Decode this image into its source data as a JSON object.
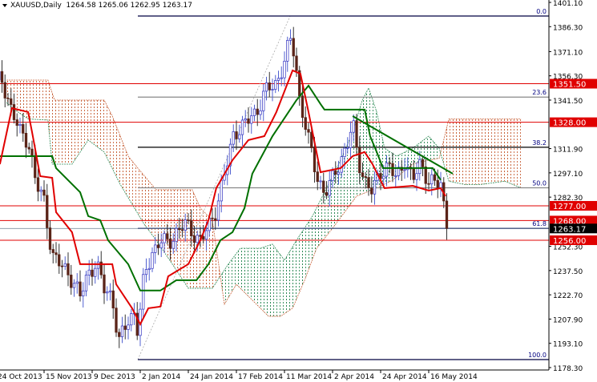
{
  "header": {
    "symbol_timeframe": "XAUUSD,Daily",
    "ohlc": "1264.58 1265.06 1262.95 1263.17"
  },
  "chart_data": {
    "type": "candlestick",
    "title": "XAUUSD,Daily",
    "ylim": [
      1178.3,
      1401.1
    ],
    "y_ticks": [
      "1401.10",
      "1386.30",
      "1371.10",
      "1356.30",
      "1341.50",
      "1311.90",
      "1297.10",
      "1282.30",
      "1252.30",
      "1237.50",
      "1222.70",
      "1207.90",
      "1193.10",
      "1178.30"
    ],
    "x_ticks": [
      {
        "bar": 0,
        "label": "24 Oct 2013"
      },
      {
        "bar": 16,
        "label": "15 Nov 2013"
      },
      {
        "bar": 32,
        "label": "9 Dec 2013"
      },
      {
        "bar": 48,
        "label": "2 Jan 2014"
      },
      {
        "bar": 64,
        "label": "24 Jan 2014"
      },
      {
        "bar": 80,
        "label": "17 Feb 2014"
      },
      {
        "bar": 96,
        "label": "11 Mar 2014"
      },
      {
        "bar": 112,
        "label": "2 Apr 2014"
      },
      {
        "bar": 128,
        "label": "24 Apr 2014"
      },
      {
        "bar": 144,
        "label": "16 May 2014"
      }
    ],
    "last_bar": 150,
    "price_path": [
      [
        2.1,
        1353.7
      ],
      [
        5.3,
        1334.2
      ],
      [
        8,
        1322
      ],
      [
        10.7,
        1317.1
      ],
      [
        13.3,
        1290.2
      ],
      [
        16,
        1280.4
      ],
      [
        18.7,
        1246.2
      ],
      [
        21.3,
        1241.4
      ],
      [
        24,
        1236.5
      ],
      [
        28,
        1221.8
      ],
      [
        30.7,
        1236.5
      ],
      [
        33.3,
        1241.4
      ],
      [
        36,
        1226.7
      ],
      [
        38.7,
        1221.8
      ],
      [
        40.8,
        1192.5
      ],
      [
        42.7,
        1202.3
      ],
      [
        44,
        1207.2
      ],
      [
        46.1,
        1212.1
      ],
      [
        47.2,
        1199.8
      ],
      [
        49.3,
        1234
      ],
      [
        52,
        1248.7
      ],
      [
        54.7,
        1256
      ],
      [
        57.3,
        1253.6
      ],
      [
        60,
        1260.9
      ],
      [
        62.7,
        1265.8
      ],
      [
        65.3,
        1260.9
      ],
      [
        68,
        1256
      ],
      [
        70.7,
        1263.3
      ],
      [
        73.3,
        1275.6
      ],
      [
        75.5,
        1292.7
      ],
      [
        77.3,
        1304.9
      ],
      [
        79.2,
        1322
      ],
      [
        81.3,
        1324.4
      ],
      [
        84,
        1329.3
      ],
      [
        86.7,
        1334.2
      ],
      [
        89.3,
        1346.4
      ],
      [
        93.3,
        1351.3
      ],
      [
        96,
        1365.9
      ],
      [
        97.9,
        1378.2
      ],
      [
        99.5,
        1368.4
      ],
      [
        100.8,
        1344
      ],
      [
        102.7,
        1329.3
      ],
      [
        104.8,
        1309.8
      ],
      [
        106.7,
        1295.1
      ],
      [
        109.3,
        1285.3
      ],
      [
        112,
        1292.7
      ],
      [
        114.7,
        1304.9
      ],
      [
        117.3,
        1317.1
      ],
      [
        118.7,
        1326.9
      ],
      [
        120.5,
        1304.9
      ],
      [
        122.7,
        1292.7
      ],
      [
        125.3,
        1285.3
      ],
      [
        128,
        1297.5
      ],
      [
        130.7,
        1302.4
      ],
      [
        133.3,
        1292.7
      ],
      [
        136,
        1304.9
      ],
      [
        138.7,
        1292.7
      ],
      [
        141.3,
        1302.4
      ],
      [
        144,
        1292.7
      ],
      [
        146.7,
        1290.2
      ],
      [
        148.5,
        1289.2
      ],
      [
        149.6,
        1263.17
      ]
    ],
    "tenkan_sen": {
      "color": "#e00000",
      "points": [
        [
          1.3,
          1302.4
        ],
        [
          5.3,
          1336.6
        ],
        [
          10.7,
          1334.2
        ],
        [
          12,
          1322
        ],
        [
          14.7,
          1295.1
        ],
        [
          18.7,
          1294.1
        ],
        [
          20,
          1273.1
        ],
        [
          25.3,
          1260.9
        ],
        [
          28,
          1241.4
        ],
        [
          38.7,
          1241.4
        ],
        [
          40,
          1229.1
        ],
        [
          45.3,
          1214.5
        ],
        [
          48,
          1204.7
        ],
        [
          50.7,
          1214.5
        ],
        [
          54.7,
          1215.5
        ],
        [
          57.3,
          1234
        ],
        [
          64,
          1241.4
        ],
        [
          68,
          1256
        ],
        [
          70.7,
          1268.2
        ],
        [
          73.3,
          1287.8
        ],
        [
          78.7,
          1304.9
        ],
        [
          84,
          1317.1
        ],
        [
          89.3,
          1319.5
        ],
        [
          93.3,
          1334.2
        ],
        [
          98.7,
          1359.6
        ],
        [
          101.3,
          1357.6
        ],
        [
          104,
          1334.2
        ],
        [
          108,
          1297.5
        ],
        [
          114.7,
          1300
        ],
        [
          118.7,
          1307.3
        ],
        [
          122.7,
          1309.8
        ],
        [
          125.3,
          1302.4
        ],
        [
          129.3,
          1287.8
        ],
        [
          138.7,
          1289.2
        ],
        [
          144,
          1286.3
        ],
        [
          148,
          1287.8
        ],
        [
          149.6,
          1282.9
        ]
      ]
    },
    "kijun_sen": {
      "color": "#007000",
      "points": [
        [
          1.3,
          1307.3
        ],
        [
          18.7,
          1307.3
        ],
        [
          20,
          1300
        ],
        [
          28,
          1285.3
        ],
        [
          30.7,
          1270.7
        ],
        [
          34.7,
          1268.2
        ],
        [
          37.3,
          1256
        ],
        [
          44,
          1241.4
        ],
        [
          48,
          1225.3
        ],
        [
          54.7,
          1225.3
        ],
        [
          60,
          1231.6
        ],
        [
          66.7,
          1231.6
        ],
        [
          70.7,
          1241.4
        ],
        [
          74.7,
          1256
        ],
        [
          78.7,
          1260.9
        ],
        [
          82.7,
          1275.6
        ],
        [
          85.3,
          1296.6
        ],
        [
          92,
          1319.5
        ],
        [
          100,
          1341.5
        ],
        [
          104,
          1350.3
        ],
        [
          108,
          1339.1
        ],
        [
          109.3,
          1335.7
        ],
        [
          122.7,
          1335.7
        ],
        [
          124.5,
          1319.5
        ],
        [
          126.7,
          1309.8
        ],
        [
          128.8,
          1300
        ],
        [
          145.3,
          1300
        ],
        [
          148,
          1292.7
        ]
      ]
    },
    "senkou_span_a": [
      [
        3.5,
        1340
      ],
      [
        6.7,
        1335
      ],
      [
        10.7,
        1330
      ],
      [
        17.3,
        1329.3
      ],
      [
        18.7,
        1302.4
      ],
      [
        25.3,
        1302.4
      ],
      [
        30.7,
        1317.1
      ],
      [
        36,
        1309.8
      ],
      [
        41.3,
        1290.2
      ],
      [
        45.3,
        1278
      ],
      [
        49.3,
        1265.8
      ],
      [
        53.3,
        1256
      ],
      [
        58.7,
        1241.4
      ],
      [
        64,
        1226.7
      ],
      [
        72,
        1226.7
      ],
      [
        77.3,
        1241.4
      ],
      [
        81.3,
        1251.1
      ],
      [
        88,
        1251.1
      ],
      [
        92,
        1253.6
      ],
      [
        96,
        1243.8
      ],
      [
        100,
        1256
      ],
      [
        105.3,
        1270.7
      ],
      [
        109.3,
        1285.3
      ],
      [
        114.7,
        1304.9
      ],
      [
        118.7,
        1322
      ],
      [
        121.9,
        1341.5
      ],
      [
        124,
        1348.9
      ],
      [
        126.7,
        1334.2
      ],
      [
        129.3,
        1312.2
      ],
      [
        133.3,
        1307.3
      ],
      [
        138.7,
        1312.2
      ],
      [
        144,
        1319.5
      ],
      [
        147.5,
        1312
      ],
      [
        150.7,
        1292
      ],
      [
        156,
        1290
      ],
      [
        161.3,
        1290
      ],
      [
        169.3,
        1292
      ],
      [
        174.7,
        1288
      ]
    ],
    "senkou_span_b": [
      [
        3.5,
        1353.7
      ],
      [
        17.3,
        1353.7
      ],
      [
        19.5,
        1341.5
      ],
      [
        36,
        1341.5
      ],
      [
        38.7,
        1331.8
      ],
      [
        44,
        1307.3
      ],
      [
        47.2,
        1300
      ],
      [
        53.3,
        1286.8
      ],
      [
        65.3,
        1286.8
      ],
      [
        68,
        1275.6
      ],
      [
        72,
        1268.2
      ],
      [
        76,
        1216.9
      ],
      [
        80,
        1229.1
      ],
      [
        84,
        1221.8
      ],
      [
        90.7,
        1209.6
      ],
      [
        94.7,
        1209.6
      ],
      [
        98.7,
        1214.5
      ],
      [
        102.7,
        1231.6
      ],
      [
        106.7,
        1251.1
      ],
      [
        112,
        1263.3
      ],
      [
        116,
        1273.1
      ],
      [
        120,
        1282.9
      ],
      [
        126.7,
        1287.8
      ],
      [
        132,
        1292.7
      ],
      [
        138.7,
        1302.4
      ],
      [
        144,
        1304.9
      ],
      [
        147.5,
        1306
      ],
      [
        150.7,
        1330
      ],
      [
        156,
        1330
      ],
      [
        161.3,
        1330
      ],
      [
        169.3,
        1330
      ],
      [
        174.7,
        1330
      ]
    ],
    "cloud_colors": {
      "bullish": "#2e8b57",
      "bearish": "#c8643c"
    },
    "horizontal_levels": [
      {
        "price": 1351.5,
        "label": "1351.50"
      },
      {
        "price": 1328.0,
        "label": "1328.00"
      },
      {
        "price": 1277.0,
        "label": "1277.00"
      },
      {
        "price": 1268.0,
        "label": "1268.00"
      },
      {
        "price": 1256.0,
        "label": "1256.00"
      }
    ],
    "level_color": "#e00000",
    "current_price": {
      "price": 1263.17,
      "label": "1263.17"
    },
    "fibonacci": {
      "start_bar": 47.2,
      "high": 1392.8,
      "low": 1183.2,
      "high_bar": 97.9,
      "levels": [
        {
          "ratio": 0.0,
          "label": "0.0",
          "color": "#000040"
        },
        {
          "ratio": 23.6,
          "label": "23.6",
          "color": "#888888"
        },
        {
          "ratio": 38.2,
          "label": "38.2",
          "color": "#000000"
        },
        {
          "ratio": 50.0,
          "label": "50.0",
          "color": "#888888"
        },
        {
          "ratio": 61.8,
          "label": "61.8",
          "color": "#3a4a7a"
        },
        {
          "ratio": 100.0,
          "label": "100.0",
          "color": "#000040"
        }
      ]
    },
    "trendline": {
      "color": "#007000",
      "from": [
        118.7,
        1331.7
      ],
      "to": [
        152,
        1296.6
      ]
    },
    "bull_color": "#3030c0",
    "bear_color": "#5a2418"
  }
}
